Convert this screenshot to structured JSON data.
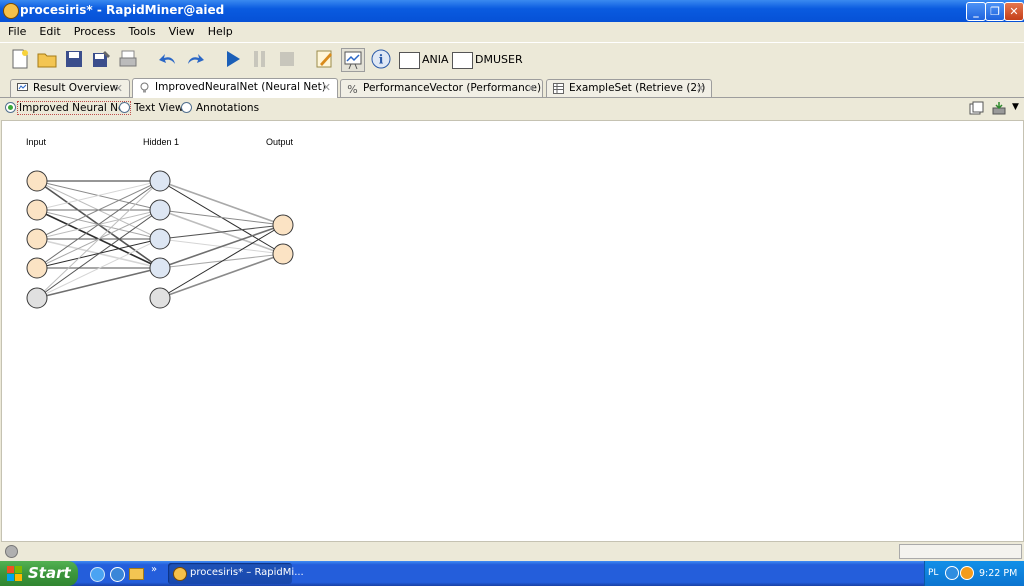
{
  "window": {
    "title": "procesiris* - RapidMiner@aied"
  },
  "menu": [
    "File",
    "Edit",
    "Process",
    "Tools",
    "View",
    "Help"
  ],
  "toolbar": {
    "input1_label": "ANIA",
    "input2_label": "DMUSER"
  },
  "tabs": [
    {
      "label": "Result Overview",
      "icon": "monitor-icon"
    },
    {
      "label": "ImprovedNeuralNet (Neural Net)",
      "icon": "bulb-icon"
    },
    {
      "label": "PerformanceVector (Performance)",
      "icon": "percent-icon"
    },
    {
      "label": "ExampleSet (Retrieve (2))",
      "icon": "table-icon"
    }
  ],
  "view_options": {
    "selected": "Improved Neural Net",
    "items": [
      "Improved Neural Net",
      "Text View",
      "Annotations"
    ]
  },
  "neural_net": {
    "layers": [
      {
        "label": "Input",
        "nodes": 5
      },
      {
        "label": "Hidden 1",
        "nodes": 5
      },
      {
        "label": "Output",
        "nodes": 2
      }
    ],
    "colors": {
      "input_node": "#fbe3c4",
      "hidden_node": "#dde6f3",
      "bias_node": "#e0e0e0",
      "output_node": "#fbe3c4"
    }
  },
  "taskbar": {
    "start_label": "Start",
    "task_label": "procesiris* – RapidMi...",
    "tray_lang": "PL",
    "clock": "9:22 PM"
  }
}
